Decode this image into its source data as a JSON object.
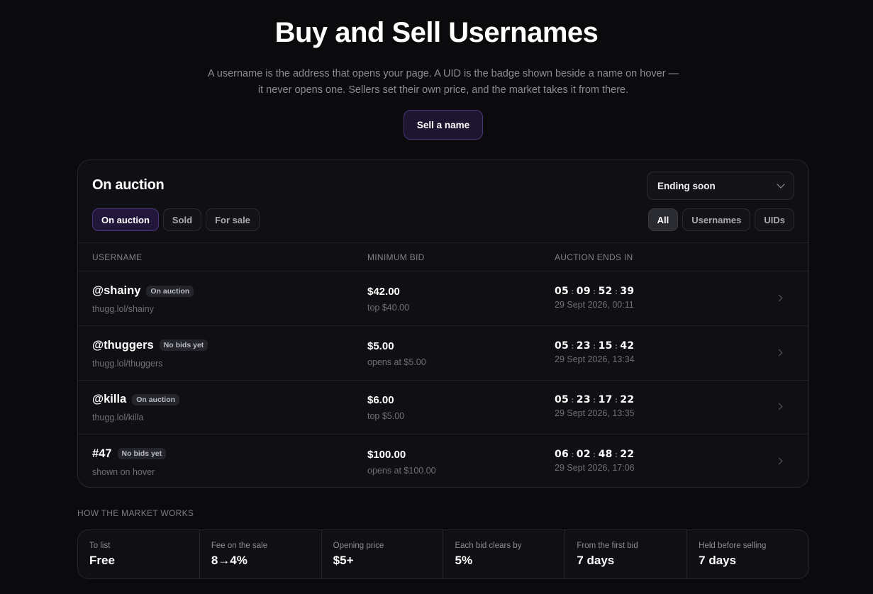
{
  "hero": {
    "title": "Buy and Sell Usernames",
    "subtitle": "A username is the address that opens your page. A UID is the badge shown beside a name on hover — it never opens one. Sellers set their own price, and the market takes it from there.",
    "sell_button": "Sell a name"
  },
  "panel": {
    "title": "On auction",
    "sort_value": "Ending soon",
    "status_tabs": [
      "On auction",
      "Sold",
      "For sale"
    ],
    "type_tabs": [
      "All",
      "Usernames",
      "UIDs"
    ],
    "columns": [
      "USERNAME",
      "MINIMUM BID",
      "AUCTION ENDS IN"
    ],
    "rows": [
      {
        "prefix": "@",
        "name": "shainy",
        "badge": "On auction",
        "sub": "thugg.lol/shainy",
        "bid": "$42.00",
        "bid_sub": "top $40.00",
        "d": "05",
        "h": "09",
        "m": "52",
        "s": "39",
        "ends": "29 Sept 2026, 00:11"
      },
      {
        "prefix": "@",
        "name": "thuggers",
        "badge": "No bids yet",
        "sub": "thugg.lol/thuggers",
        "bid": "$5.00",
        "bid_sub": "opens at $5.00",
        "d": "05",
        "h": "23",
        "m": "15",
        "s": "42",
        "ends": "29 Sept 2026, 13:34"
      },
      {
        "prefix": "@",
        "name": "killa",
        "badge": "On auction",
        "sub": "thugg.lol/killa",
        "bid": "$6.00",
        "bid_sub": "top $5.00",
        "d": "05",
        "h": "23",
        "m": "17",
        "s": "22",
        "ends": "29 Sept 2026, 13:35"
      },
      {
        "prefix": "#",
        "name": "47",
        "badge": "No bids yet",
        "sub": "shown on hover",
        "bid": "$100.00",
        "bid_sub": "opens at $100.00",
        "d": "06",
        "h": "02",
        "m": "48",
        "s": "22",
        "ends": "29 Sept 2026, 17:06"
      }
    ]
  },
  "how": {
    "title": "HOW THE MARKET WORKS",
    "stats": [
      {
        "label": "To list",
        "value": "Free"
      },
      {
        "label": "Fee on the sale",
        "value": "8→4%"
      },
      {
        "label": "Opening price",
        "value": "$5+"
      },
      {
        "label": "Each bid clears by",
        "value": "5%"
      },
      {
        "label": "From the first bid",
        "value": "7 days"
      },
      {
        "label": "Held before selling",
        "value": "7 days"
      }
    ]
  },
  "colors": {
    "accent": "#4b3680",
    "background": "#0b0b0e",
    "card": "#101014"
  }
}
